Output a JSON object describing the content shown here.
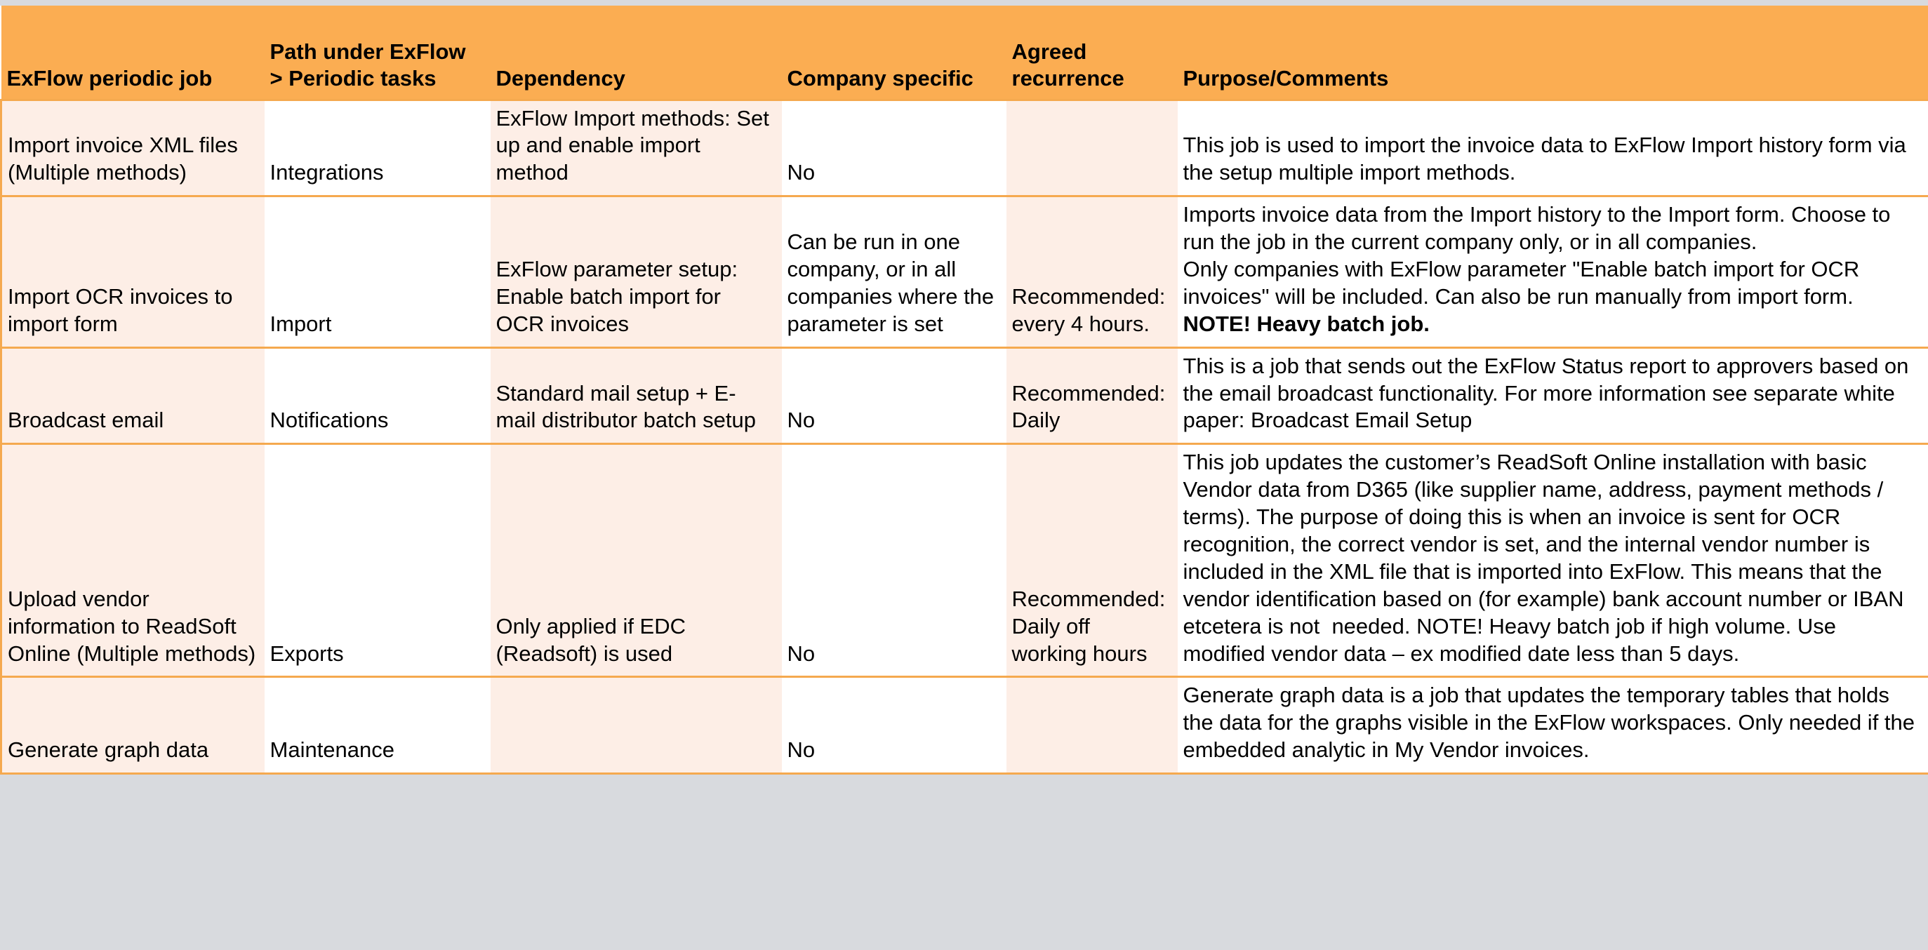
{
  "table": {
    "columns": [
      "ExFlow periodic job",
      "Path under ExFlow > Periodic tasks",
      "Dependency",
      "Company specific",
      "Agreed recurrence",
      "Purpose/Comments"
    ],
    "rows": [
      {
        "job": "Import invoice XML files (Multiple methods)",
        "path": "Integrations",
        "dependency": "ExFlow Import methods: Set up and enable import method",
        "company_specific": "No",
        "recurrence": "",
        "purpose": "This job is used to import the invoice data to ExFlow Import history form via the setup multiple import methods.",
        "purpose_bold_tail": ""
      },
      {
        "job": "Import OCR invoices to import form",
        "path": "Import",
        "dependency": "ExFlow parameter setup: Enable batch import for OCR invoices",
        "company_specific": "Can be run in one company, or in all companies where the parameter is set",
        "recurrence": "Recommended: every 4 hours.",
        "purpose": "Imports invoice data from the Import history to the Import form. Choose to run the job in the current company only, or in all companies.\nOnly companies with ExFlow parameter \"Enable batch import for OCR invoices\" will be included. Can also be run manually from import form. ",
        "purpose_bold_tail": "NOTE! Heavy batch job."
      },
      {
        "job": "Broadcast email",
        "path": "Notifications",
        "dependency": "Standard mail setup + E-mail distributor batch setup",
        "company_specific": "No",
        "recurrence": "Recommended: Daily",
        "purpose": "This is a job that sends out the ExFlow Status report to approvers based on the email broadcast functionality. For more information see separate white  paper: Broadcast Email Setup",
        "purpose_bold_tail": ""
      },
      {
        "job": "Upload vendor information to ReadSoft Online (Multiple methods)",
        "path": "Exports",
        "dependency": "Only applied if EDC (Readsoft) is used",
        "company_specific": "No",
        "recurrence": "Recommended: Daily off working hours",
        "purpose": "This job updates the customer’s ReadSoft Online installation with basic Vendor data from D365 (like supplier name, address, payment methods / terms). The purpose of doing this is when an invoice is sent for OCR recognition, the correct vendor is set, and the internal vendor number is included in the XML file that is imported into ExFlow. This means that the vendor identification based on (for example) bank account number or IBAN etcetera is not  needed. NOTE! Heavy batch job if high volume. Use modified vendor data – ex modified date less than 5 days.",
        "purpose_bold_tail": ""
      },
      {
        "job": "Generate graph data",
        "path": "Maintenance",
        "dependency": "",
        "company_specific": "No",
        "recurrence": "",
        "purpose": "Generate graph data is a job that updates the temporary tables that holds the data for the graphs visible in the ExFlow workspaces. Only needed if the embedded analytic in My Vendor invoices.",
        "purpose_bold_tail": ""
      }
    ]
  },
  "colors": {
    "header_background": "#fbad52",
    "cell_tint": "#fdeee6",
    "cell_plain": "#ffffff",
    "border": "#f5a94f",
    "page_background": "#d8dade",
    "text": "#000000"
  }
}
